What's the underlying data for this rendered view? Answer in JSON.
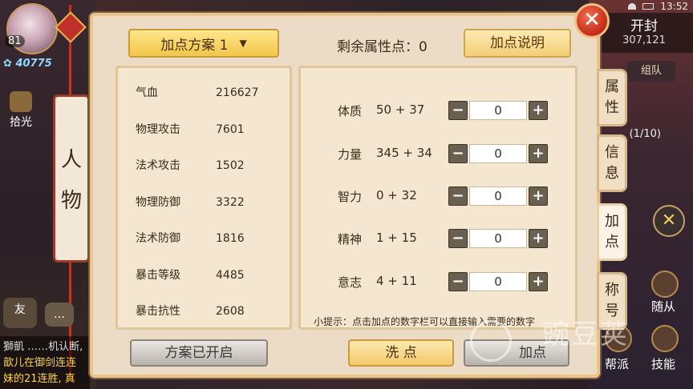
{
  "status_bar": {
    "time": "13:52"
  },
  "hud": {
    "level": "81",
    "power": "40775",
    "pickup_label": "拾光",
    "person_label": [
      "人",
      "物"
    ],
    "friend_label": "友",
    "chat_label": "…",
    "chat_lines": [
      "獅凱 ……机认断,",
      "歆儿在御剑连连",
      "妹的21连胜, 真"
    ],
    "open_seal": {
      "label": "开封",
      "number": "307,121"
    },
    "team_label": "组队",
    "quest_fragment": "(1/10)",
    "pet_label": "随从",
    "guild_label": "帮派",
    "skill_label": "技能"
  },
  "panel": {
    "scheme_select": {
      "label": "加点方案 1",
      "chevron": "chevron-down-icon"
    },
    "remaining_label": "剩余属性点：",
    "remaining_value": "0",
    "help_button": "加点说明",
    "close_icon": "close-icon",
    "stats": [
      {
        "name": "气血",
        "value": "216627"
      },
      {
        "name": "物理攻击",
        "value": "7601"
      },
      {
        "name": "法术攻击",
        "value": "1502"
      },
      {
        "name": "物理防御",
        "value": "3322"
      },
      {
        "name": "法术防御",
        "value": "1816"
      },
      {
        "name": "暴击等级",
        "value": "4485"
      },
      {
        "name": "暴击抗性",
        "value": "2608"
      }
    ],
    "attributes": [
      {
        "name": "体质",
        "value": "50 + 37",
        "input": "0"
      },
      {
        "name": "力量",
        "value": "345 + 34",
        "input": "0"
      },
      {
        "name": "智力",
        "value": "0 + 32",
        "input": "0"
      },
      {
        "name": "精神",
        "value": "1 + 15",
        "input": "0"
      },
      {
        "name": "意志",
        "value": "4 + 11",
        "input": "0"
      }
    ],
    "minus_symbol": "−",
    "plus_symbol": "+",
    "tip": "小提示：点击加点的数字栏可以直接输入需要的数字",
    "tabs": [
      {
        "label": [
          "属",
          "性"
        ],
        "active": false
      },
      {
        "label": [
          "信",
          "息"
        ],
        "active": false
      },
      {
        "label": [
          "加",
          "点"
        ],
        "active": true
      },
      {
        "label": [
          "称",
          "号"
        ],
        "active": false
      }
    ],
    "buttons": {
      "scheme_enabled": "方案已开启",
      "wash": "洗 点",
      "add_points": "加点"
    }
  },
  "watermark": {
    "text": "豌豆荚"
  }
}
